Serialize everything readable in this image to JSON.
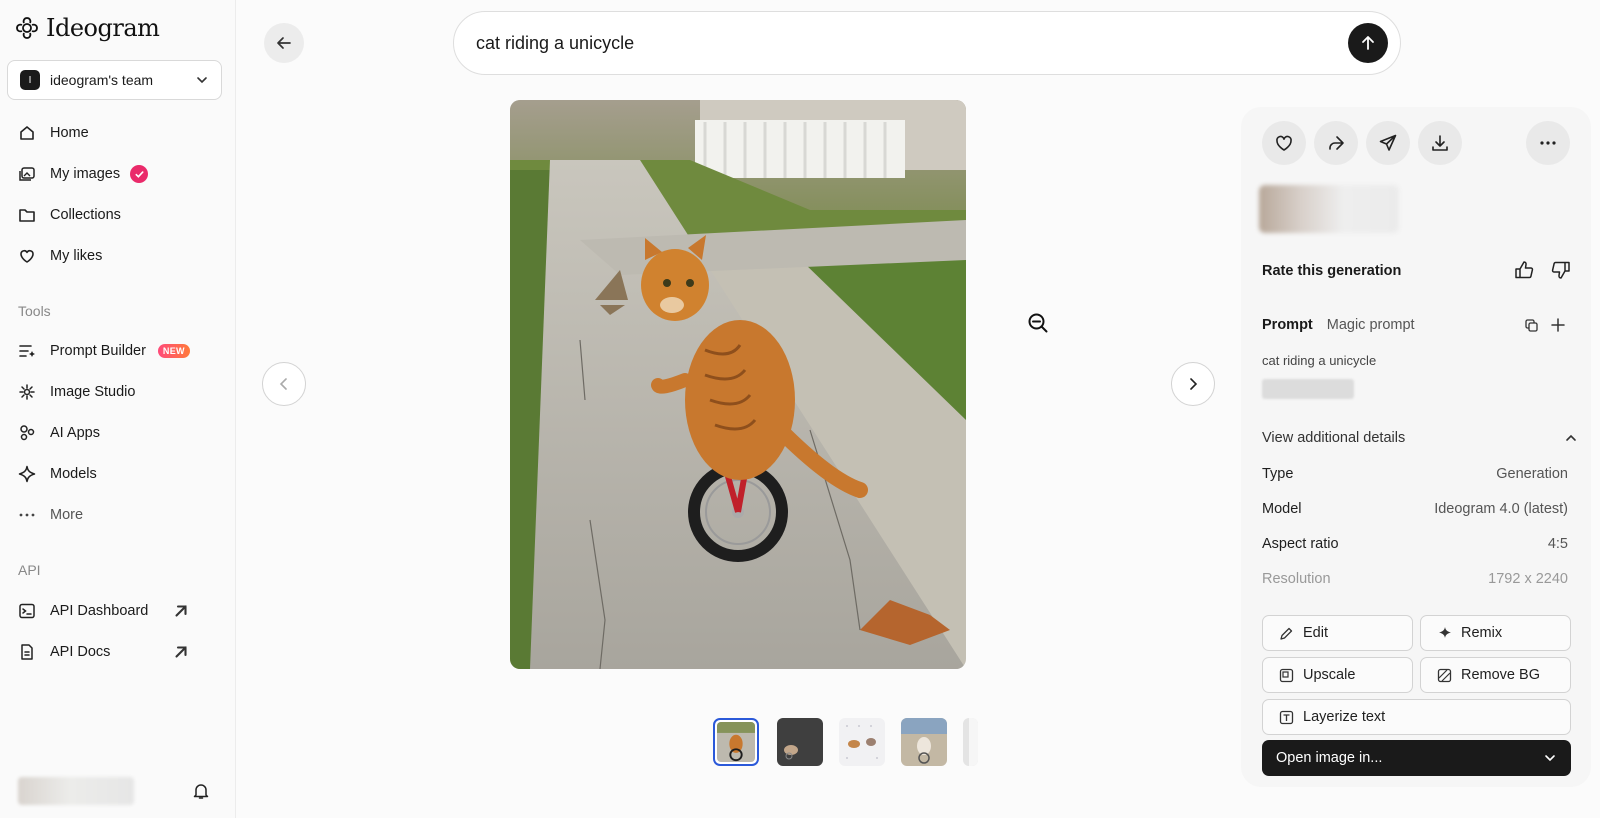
{
  "app": {
    "name": "Ideogram"
  },
  "team": {
    "badge": "I",
    "name": "ideogram's team"
  },
  "sidebar": {
    "items": [
      {
        "label": "Home",
        "icon": "home-icon"
      },
      {
        "label": "My images",
        "icon": "images-icon"
      },
      {
        "label": "Collections",
        "icon": "folder-icon"
      },
      {
        "label": "My likes",
        "icon": "heart-icon"
      }
    ],
    "tools_label": "Tools",
    "tools": [
      {
        "label": "Prompt Builder",
        "icon": "prompt-builder-icon",
        "badge": "NEW"
      },
      {
        "label": "Image Studio",
        "icon": "studio-icon"
      },
      {
        "label": "AI Apps",
        "icon": "apps-icon"
      },
      {
        "label": "Models",
        "icon": "sparkle-icon"
      },
      {
        "label": "More",
        "icon": "more-dots-icon"
      }
    ],
    "api_label": "API",
    "api": [
      {
        "label": "API Dashboard",
        "icon": "terminal-icon"
      },
      {
        "label": "API Docs",
        "icon": "docs-icon"
      }
    ]
  },
  "search": {
    "value": "cat riding a unicycle"
  },
  "panel": {
    "rate_label": "Rate this generation",
    "tabs": {
      "prompt": "Prompt",
      "magic": "Magic prompt"
    },
    "prompt_text": "cat riding a unicycle",
    "details_label": "View additional details",
    "details": [
      {
        "key": "Type",
        "value": "Generation"
      },
      {
        "key": "Model",
        "value": "Ideogram 4.0 (latest)"
      },
      {
        "key": "Aspect ratio",
        "value": "4:5"
      },
      {
        "key": "Resolution",
        "value": "1792 x 2240"
      }
    ],
    "actions": {
      "edit": "Edit",
      "remix": "Remix",
      "upscale": "Upscale",
      "remove_bg": "Remove BG",
      "layerize": "Layerize text",
      "open_in": "Open image in..."
    }
  },
  "colors": {
    "accent_pink": "#ea2a6a",
    "selected_thumb_border": "#2b59d9",
    "dark": "#1a1a1a"
  }
}
